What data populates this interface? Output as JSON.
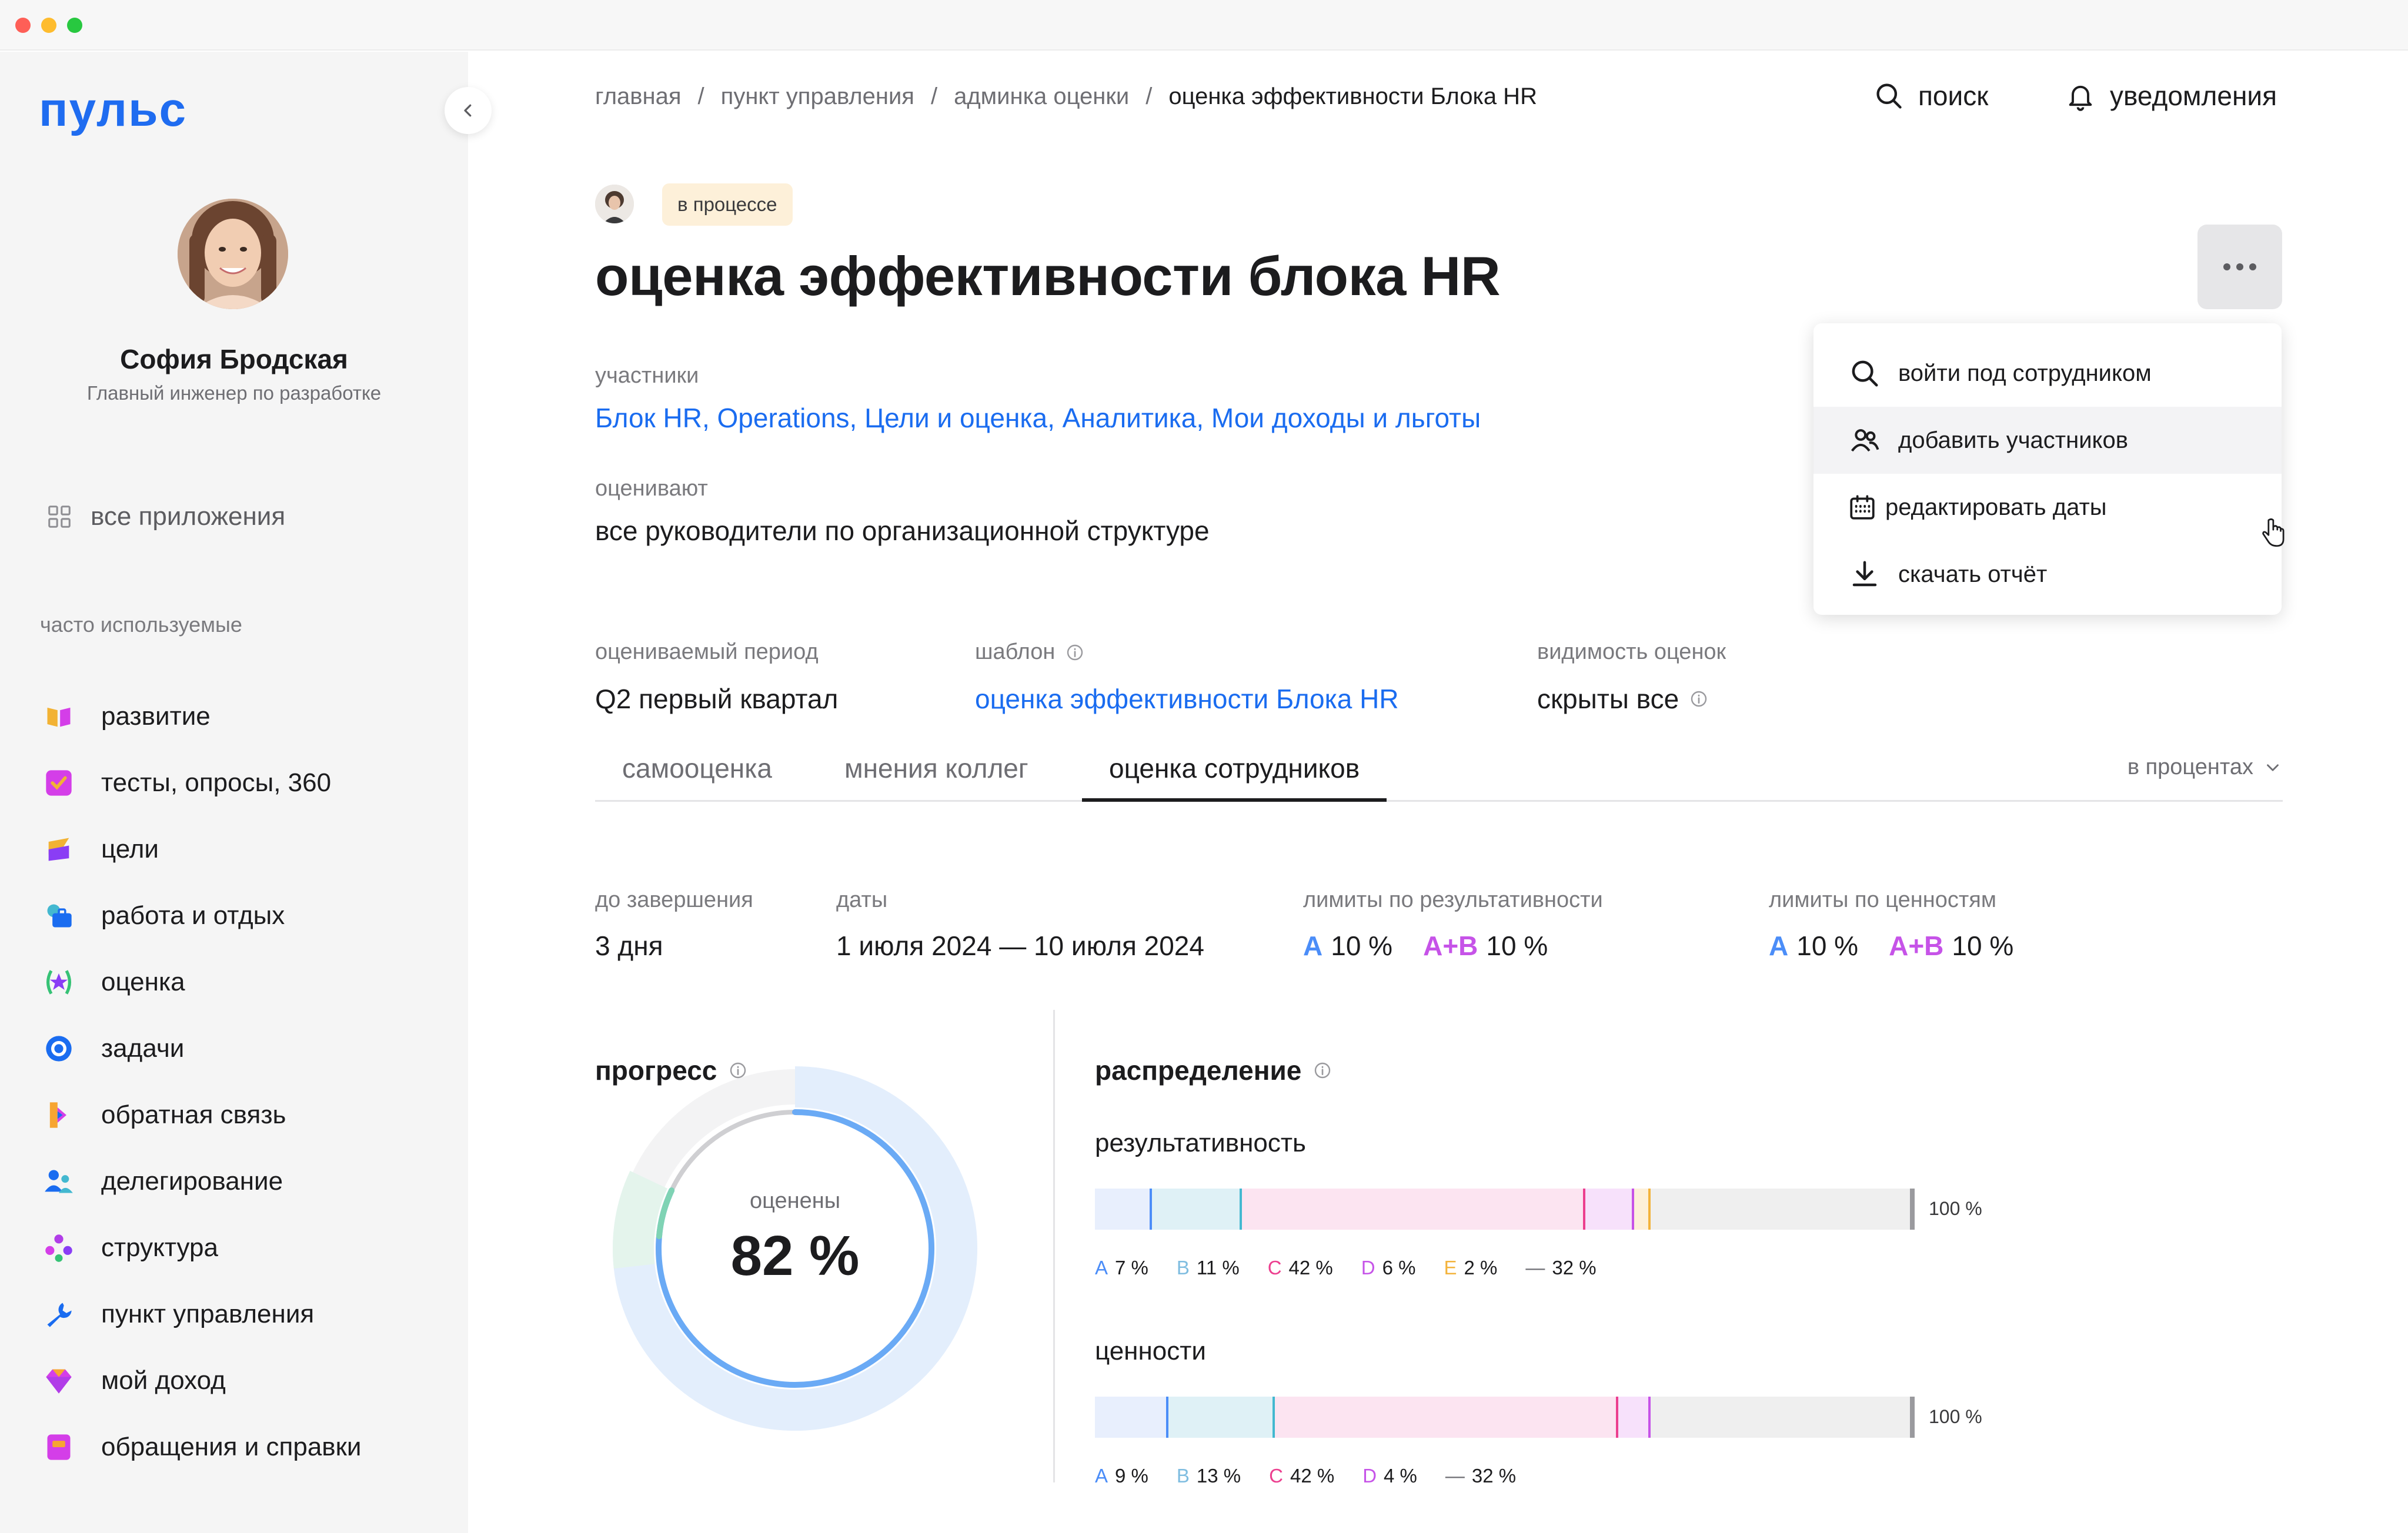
{
  "window": {
    "close": "",
    "minimize": "",
    "maximize": ""
  },
  "sidebar": {
    "logo": "пульс",
    "user": {
      "name": "София Бродская",
      "role": "Главный инженер по разработке"
    },
    "all_apps": "все приложения",
    "section_label": "часто используемые",
    "items": [
      {
        "label": "развитие",
        "icon": "book-icon",
        "color": "#f2b234"
      },
      {
        "label": "тесты, опросы, 360",
        "icon": "checkbox-icon",
        "color": "#d43ee8"
      },
      {
        "label": "цели",
        "icon": "target-flag-icon",
        "color": "#8a3df5"
      },
      {
        "label": "работа и отдых",
        "icon": "briefcase-sun-icon",
        "color": "#1a6cf0"
      },
      {
        "label": "оценка",
        "icon": "star-badge-icon",
        "color": "#8a3df5"
      },
      {
        "label": "задачи",
        "icon": "target-circle-icon",
        "color": "#1a6cf0"
      },
      {
        "label": "обратная связь",
        "icon": "feedback-icon",
        "color": "#f7a531"
      },
      {
        "label": "делегирование",
        "icon": "people-icon",
        "color": "#1a6cf0"
      },
      {
        "label": "структура",
        "icon": "structure-icon",
        "color": "#b13de8"
      },
      {
        "label": "пункт управления",
        "icon": "wrench-icon",
        "color": "#1a6cf0"
      },
      {
        "label": "мой доход",
        "icon": "diamond-icon",
        "color": "#d43ee8"
      },
      {
        "label": "обращения и справки",
        "icon": "document-icon",
        "color": "#d43ee8"
      }
    ]
  },
  "header": {
    "breadcrumbs": [
      "главная",
      "пункт управления",
      "админка оценки",
      "оценка эффективности Блока HR"
    ],
    "separator": "/",
    "search_label": "поиск",
    "notifications_label": "уведомления"
  },
  "evaluation": {
    "status": "в процессе",
    "title": "оценка эффективности блока HR",
    "participants_label": "участники",
    "participants_value": "Блок HR, Operations, Цели и оценка, Аналитика, Мои доходы и льготы",
    "evaluators_label": "оценивают",
    "evaluators_value": "все руководители по организационной структуре",
    "period_label": "оцениваемый период",
    "period_value": "Q2 первый квартал",
    "template_label": "шаблон",
    "template_value": "оценка эффективности Блока HR",
    "visibility_label": "видимость оценок",
    "visibility_value": "скрыты все"
  },
  "menu": {
    "items": [
      {
        "label": "войти под сотрудником",
        "icon": "search-icon"
      },
      {
        "label": "добавить участников",
        "icon": "users-icon"
      },
      {
        "label": "редактировать даты",
        "icon": "calendar-icon"
      },
      {
        "label": "скачать отчёт",
        "icon": "download-icon"
      }
    ]
  },
  "tabs": {
    "items": [
      "самооценка",
      "мнения коллег",
      "оценка сотрудников"
    ],
    "active": "оценка сотрудников",
    "units": "в процентах"
  },
  "summary": {
    "deadline_label": "до завершения",
    "deadline_value": "3 дня",
    "dates_label": "даты",
    "dates_value": "1 июля 2024 — 10 июля 2024",
    "perf_limits_label": "лимиты по результативности",
    "values_limits_label": "лимиты по ценностям",
    "limit_a_key": "A",
    "limit_ab_key": "A+B",
    "perf_a": "10 %",
    "perf_ab": "10 %",
    "values_a": "10 %",
    "values_ab": "10 %"
  },
  "progress": {
    "title": "прогресс",
    "caption": "оценены",
    "value_text": "82 %",
    "value": 82
  },
  "distribution": {
    "title": "распределение",
    "end_label": "100 %",
    "performance": {
      "label": "результативность",
      "segments": [
        {
          "key": "A",
          "value": 7,
          "text": "7 %"
        },
        {
          "key": "B",
          "value": 11,
          "text": "11 %"
        },
        {
          "key": "C",
          "value": 42,
          "text": "42 %"
        },
        {
          "key": "D",
          "value": 6,
          "text": "6 %"
        },
        {
          "key": "E",
          "value": 2,
          "text": "2 %"
        },
        {
          "key": "—",
          "value": 32,
          "text": "32 %"
        }
      ]
    },
    "values": {
      "label": "ценности",
      "segments": [
        {
          "key": "A",
          "value": 9,
          "text": "9 %"
        },
        {
          "key": "B",
          "value": 13,
          "text": "13 %"
        },
        {
          "key": "C",
          "value": 42,
          "text": "42 %"
        },
        {
          "key": "D",
          "value": 4,
          "text": "4 %"
        },
        {
          "key": "—",
          "value": 32,
          "text": "32 %"
        }
      ]
    },
    "colors": {
      "A": {
        "fill": "#e8effd",
        "mark": "#4b8df8",
        "text": "#4b8df8"
      },
      "B": {
        "fill": "#dff1f6",
        "mark": "#43b8d0",
        "text": "#7fbde0"
      },
      "C": {
        "fill": "#fce4f1",
        "mark": "#ec3f8f",
        "text": "#ec3f8f"
      },
      "D": {
        "fill": "#f7e1fb",
        "mark": "#c653e8",
        "text": "#c653e8"
      },
      "E": {
        "fill": "#fdf0d9",
        "mark": "#f3b33c",
        "text": "#f3b33c"
      },
      "—": {
        "fill": "#efefef",
        "mark": "#9a9a9e",
        "text": "#6e6e73"
      }
    }
  }
}
